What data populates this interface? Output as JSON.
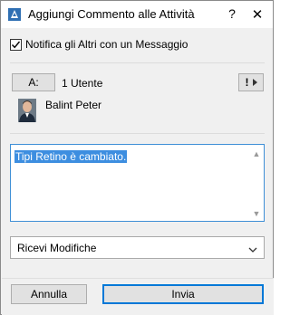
{
  "window": {
    "title": "Aggiungi Commento alle Attività",
    "help_glyph": "?",
    "close_glyph": "✕"
  },
  "notify": {
    "label": "Notifica gli Altri con un Messaggio",
    "checked": true
  },
  "recipients": {
    "to_button_label": "A:",
    "count_label": "1 Utente",
    "priority_button_label": "!",
    "user_name": "Balint Peter"
  },
  "comment": {
    "text": "Tipi Retino è cambiato."
  },
  "action_select": {
    "value": "Ricevi Modifiche"
  },
  "buttons": {
    "cancel_label": "Annulla",
    "send_label": "Invia"
  },
  "colors": {
    "selection": "#3d8ee0",
    "focus_border": "#3f8fd6",
    "primary_button_border": "#0078d7"
  }
}
